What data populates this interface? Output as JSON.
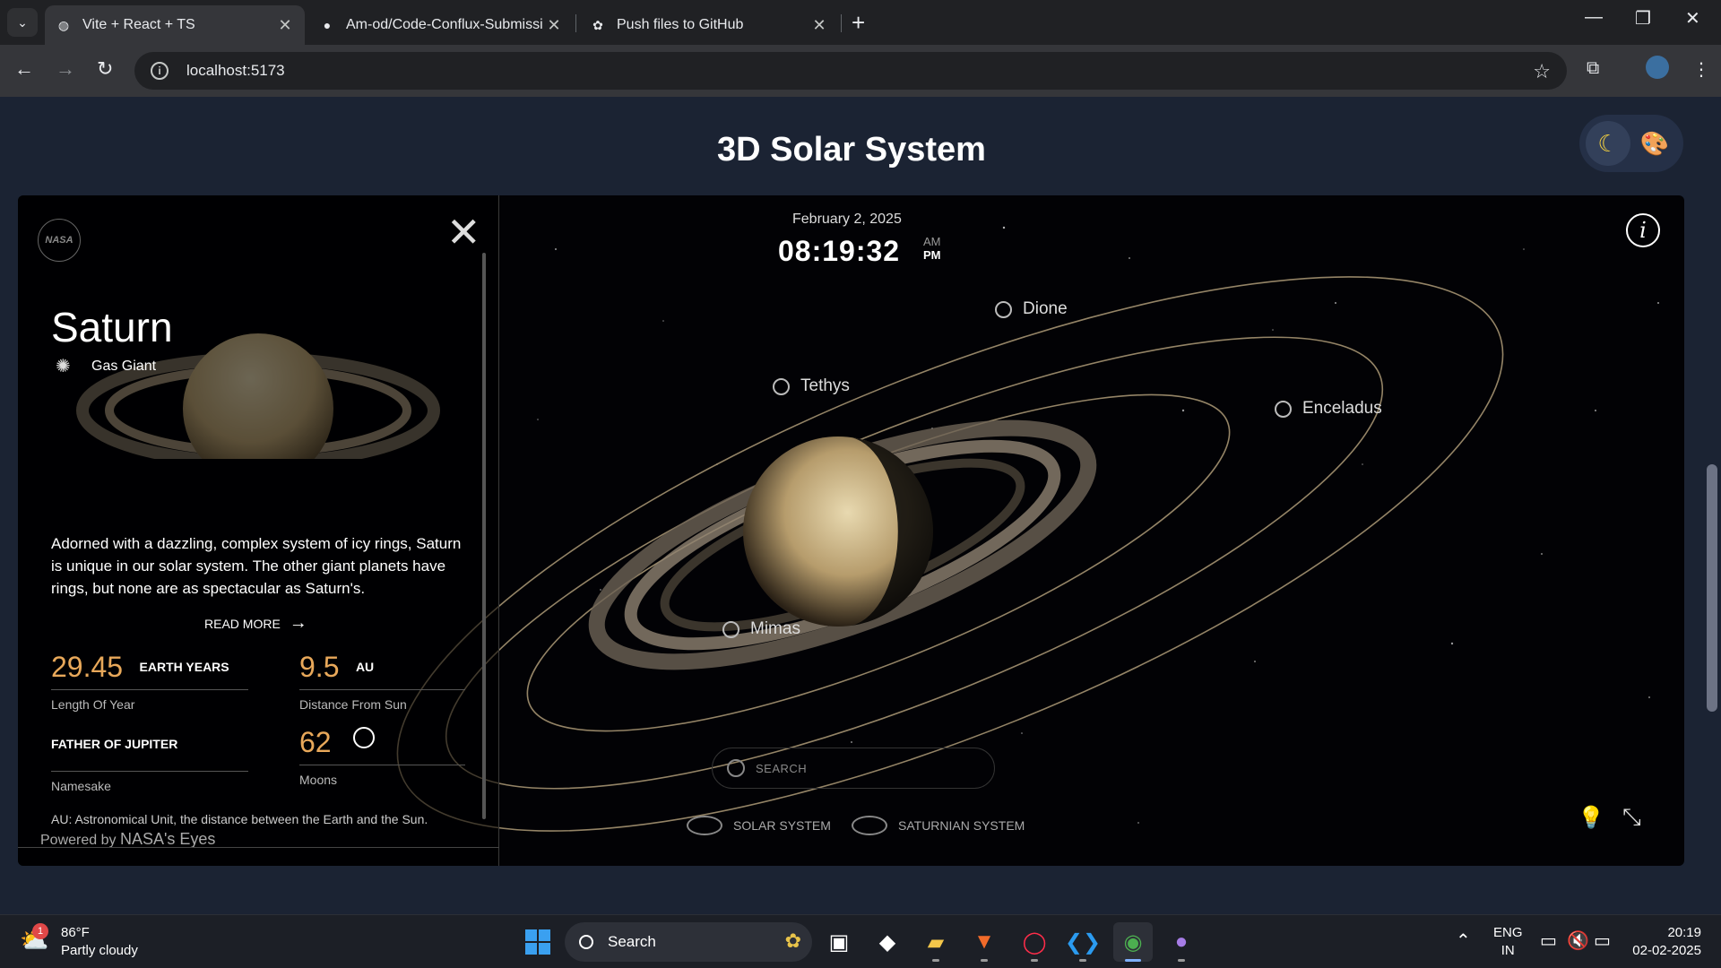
{
  "browser": {
    "tabs": [
      {
        "title": "Vite + React + TS",
        "icon": "globe-icon",
        "active": true
      },
      {
        "title": "Am-od/Code-Conflux-Submissi",
        "icon": "github-icon",
        "active": false
      },
      {
        "title": "Push files to GitHub",
        "icon": "openai-icon",
        "active": false
      }
    ],
    "url": "localhost:5173"
  },
  "page": {
    "title": "3D Solar System"
  },
  "panel": {
    "logo_text": "NASA",
    "planet": "Saturn",
    "category": "Gas Giant",
    "description": "Adorned with a dazzling, complex system of icy rings, Saturn is unique in our solar system. The other giant planets have rings, but none are as spectacular as Saturn's.",
    "read_more": "READ MORE",
    "stats": {
      "year_value": "29.45",
      "year_unit": "EARTH YEARS",
      "year_label": "Length Of Year",
      "distance_value": "9.5",
      "distance_unit": "AU",
      "distance_label": "Distance From Sun",
      "namesake_value": "FATHER OF JUPITER",
      "namesake_label": "Namesake",
      "moons_value": "62",
      "moons_label": "Moons"
    },
    "au_note": "AU: Astronomical Unit, the distance between the Earth and the Sun.",
    "powered_prefix": "Powered by",
    "powered_brand": "NASA's Eyes"
  },
  "viewport": {
    "date": "February 2, 2025",
    "time": "08:19:32",
    "am": "AM",
    "pm": "PM",
    "moons": {
      "dione": "Dione",
      "tethys": "Tethys",
      "enceladus": "Enceladus",
      "mimas": "Mimas"
    },
    "search_placeholder": "SEARCH",
    "solar_system": "SOLAR SYSTEM",
    "saturnian_system": "SATURNIAN SYSTEM"
  },
  "taskbar": {
    "weather_temp": "86°F",
    "weather_desc": "Partly cloudy",
    "weather_badge": "1",
    "search": "Search",
    "lang": "ENG",
    "region": "IN",
    "time": "20:19",
    "date": "02-02-2025"
  },
  "colors": {
    "accent_orange": "#e8a85a",
    "page_bg": "#1b2333",
    "moon_toggle": "#f4d03f"
  }
}
